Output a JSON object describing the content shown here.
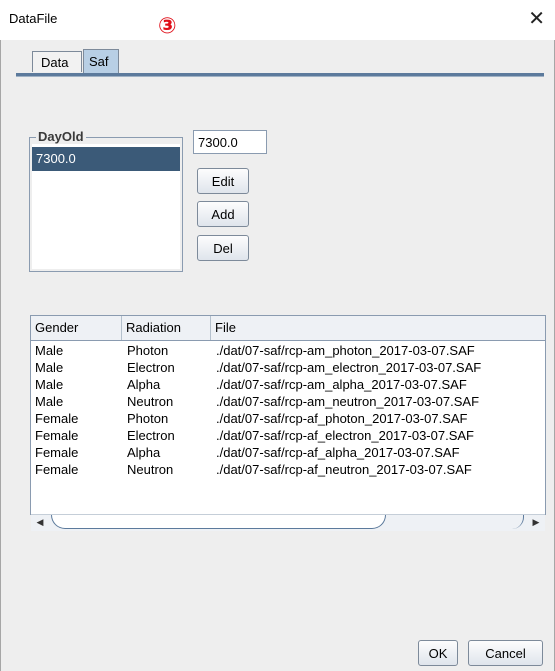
{
  "window": {
    "title": "DataFile",
    "close_glyph": "✕",
    "marker": "③"
  },
  "tabs": [
    {
      "label": "Data",
      "selected": false
    },
    {
      "label": "Saf",
      "selected": true
    }
  ],
  "dayold": {
    "group_label": "DayOld",
    "items": [
      "7300.0"
    ],
    "selected_index": 0,
    "input_value": "7300.0",
    "buttons": {
      "edit": "Edit",
      "add": "Add",
      "del": "Del"
    }
  },
  "table": {
    "columns": [
      "Gender",
      "Radiation",
      "File"
    ],
    "rows": [
      [
        "Male",
        "Photon",
        "./dat/07-saf/rcp-am_photon_2017-03-07.SAF"
      ],
      [
        "Male",
        "Electron",
        "./dat/07-saf/rcp-am_electron_2017-03-07.SAF"
      ],
      [
        "Male",
        "Alpha",
        "./dat/07-saf/rcp-am_alpha_2017-03-07.SAF"
      ],
      [
        "Male",
        "Neutron",
        "./dat/07-saf/rcp-am_neutron_2017-03-07.SAF"
      ],
      [
        "Female",
        "Photon",
        "./dat/07-saf/rcp-af_photon_2017-03-07.SAF"
      ],
      [
        "Female",
        "Electron",
        "./dat/07-saf/rcp-af_electron_2017-03-07.SAF"
      ],
      [
        "Female",
        "Alpha",
        "./dat/07-saf/rcp-af_alpha_2017-03-07.SAF"
      ],
      [
        "Female",
        "Neutron",
        "./dat/07-saf/rcp-af_neutron_2017-03-07.SAF"
      ]
    ]
  },
  "footer": {
    "ok": "OK",
    "cancel": "Cancel"
  },
  "icons": {
    "close": "close-icon",
    "scroll_left": "arrow-left-icon",
    "scroll_right": "arrow-right-icon"
  },
  "colors": {
    "selection": "#3b5a78",
    "tab_selected": "#b8cfe5",
    "accent": "#5c7a9c",
    "marker": "#e0101a"
  }
}
